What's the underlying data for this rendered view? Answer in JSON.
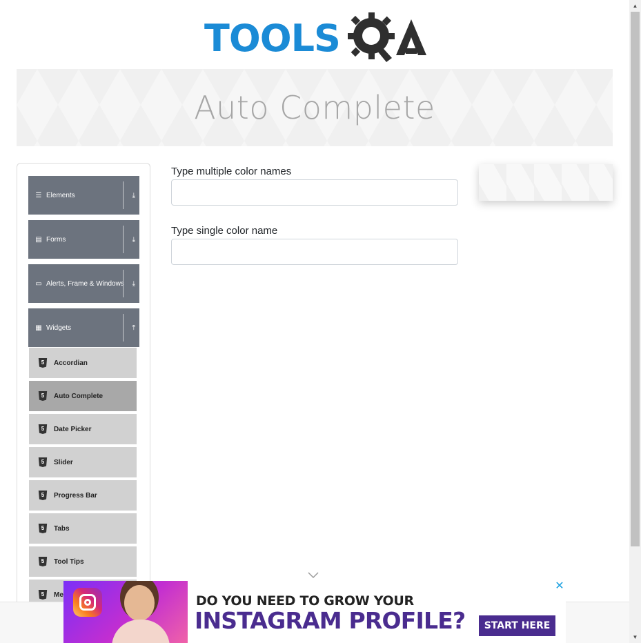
{
  "header": {
    "logo_text": "TOOLS",
    "logo_suffix": "A"
  },
  "banner": {
    "title": "Auto Complete"
  },
  "sidebar": {
    "groups": [
      {
        "label": "Elements",
        "icon": "menu-icon",
        "arrow": "download-arrow"
      },
      {
        "label": "Forms",
        "icon": "document-icon",
        "arrow": "download-arrow"
      },
      {
        "label": "Alerts, Frame & Windows",
        "icon": "window-icon",
        "arrow": "download-arrow"
      },
      {
        "label": "Widgets",
        "icon": "grid-icon",
        "arrow": "upload-arrow"
      }
    ],
    "items": [
      {
        "label": "Accordian"
      },
      {
        "label": "Auto Complete",
        "active": true
      },
      {
        "label": "Date Picker"
      },
      {
        "label": "Slider"
      },
      {
        "label": "Progress Bar"
      },
      {
        "label": "Tabs"
      },
      {
        "label": "Tool Tips"
      },
      {
        "label": "Menu"
      }
    ],
    "html5_badge": "5"
  },
  "form": {
    "multiple_label": "Type multiple color names",
    "multiple_value": "",
    "single_label": "Type single color name",
    "single_value": ""
  },
  "ad": {
    "line1": "DO YOU NEED TO GROW YOUR",
    "line2": "INSTAGRAM PROFILE?",
    "cta": "START HERE",
    "close": "✕"
  },
  "colors": {
    "logo_blue": "#1b8bd6",
    "sidebar_group": "#6c737e",
    "sidebar_item": "#d1d1d1",
    "sidebar_item_active": "#a8a8a8",
    "ad_purple": "#4a2c8f"
  }
}
